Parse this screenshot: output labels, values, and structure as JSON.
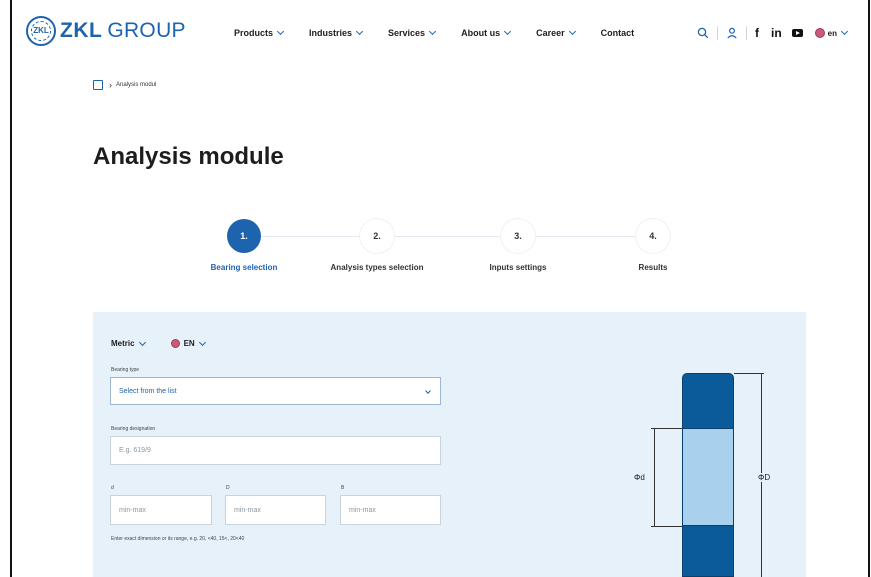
{
  "header": {
    "logo": {
      "bold": "ZKL",
      "light": "GROUP",
      "seal_text": "ZKL"
    },
    "nav": [
      {
        "label": "Products"
      },
      {
        "label": "Industries"
      },
      {
        "label": "Services"
      },
      {
        "label": "About us"
      },
      {
        "label": "Career"
      },
      {
        "label": "Contact"
      }
    ],
    "tools": {
      "search_icon": "search-icon",
      "user_icon": "user-icon",
      "facebook": "f",
      "linkedin": "in",
      "youtube_icon": "youtube-icon",
      "language": "en"
    }
  },
  "breadcrumb": {
    "home_icon": "home-icon",
    "current": "Analysis modul"
  },
  "page_title": "Analysis module",
  "stepper": {
    "steps": [
      {
        "number": "1.",
        "label": "Bearing selection",
        "active": true
      },
      {
        "number": "2.",
        "label": "Analysis types selection",
        "active": false
      },
      {
        "number": "3.",
        "label": "Inputs settings",
        "active": false
      },
      {
        "number": "4.",
        "label": "Results",
        "active": false
      }
    ]
  },
  "form": {
    "units_dropdown": "Metric",
    "language_dropdown": "EN",
    "bearing_type": {
      "label": "Bearing type",
      "value": "Select from the list"
    },
    "bearing_designation": {
      "label": "Bearing designation",
      "placeholder": "E.g. 619/9"
    },
    "dimensions": [
      {
        "label": "d",
        "placeholder": "min-max"
      },
      {
        "label": "D",
        "placeholder": "min-max"
      },
      {
        "label": "B",
        "placeholder": "min-max"
      }
    ],
    "hint": "Enter exact dimension or its range, e.g. 20, <40, 15<, 20<40"
  },
  "diagram": {
    "inner_label": "Φd",
    "outer_label": "ΦD"
  },
  "colors": {
    "brand": "#1e63ad",
    "panel": "#e6f1fa",
    "bearing_dark": "#0b5a9a",
    "bearing_light": "#a9d0ec"
  }
}
